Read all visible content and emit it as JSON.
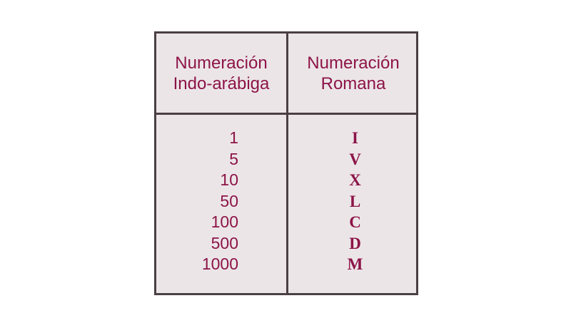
{
  "headers": {
    "arabic_line1": "Numeración",
    "arabic_line2": "Indo-arábiga",
    "roman_line1": "Numeración",
    "roman_line2": "Romana"
  },
  "rows": [
    {
      "arabic": "1",
      "roman": "I"
    },
    {
      "arabic": "5",
      "roman": "V"
    },
    {
      "arabic": "10",
      "roman": "X"
    },
    {
      "arabic": "50",
      "roman": "L"
    },
    {
      "arabic": "100",
      "roman": "C"
    },
    {
      "arabic": "500",
      "roman": "D"
    },
    {
      "arabic": "1000",
      "roman": "M"
    }
  ],
  "colors": {
    "text": "#8c1447",
    "border": "#4a3f42",
    "fill": "#ece5e8"
  }
}
